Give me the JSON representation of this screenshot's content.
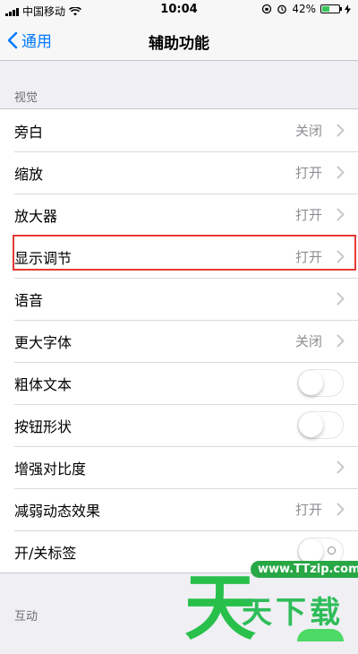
{
  "status": {
    "carrier": "中国移动",
    "time": "10:04",
    "battery": "42%",
    "battery_level": 0.42
  },
  "nav": {
    "back_label": "通用",
    "title": "辅助功能"
  },
  "sections": {
    "vision_header": "视觉",
    "interaction_header": "互动"
  },
  "rows": [
    {
      "label": "旁白",
      "value": "关闭"
    },
    {
      "label": "缩放",
      "value": "打开"
    },
    {
      "label": "放大器",
      "value": "打开"
    },
    {
      "label": "显示调节",
      "value": "打开"
    },
    {
      "label": "语音",
      "value": ""
    },
    {
      "label": "更大字体",
      "value": "关闭"
    },
    {
      "label": "粗体文本",
      "toggle": false
    },
    {
      "label": "按钮形状",
      "toggle": false
    },
    {
      "label": "增强对比度",
      "value": ""
    },
    {
      "label": "减弱动态效果",
      "value": "打开"
    },
    {
      "label": "开/关标签",
      "toggle": false
    }
  ],
  "watermark": {
    "url": "www.TTzip.com",
    "text": "天下载",
    "big": "天"
  },
  "colors": {
    "accent": "#007aff",
    "highlight": "#e53935",
    "toggle_on": "#4cd964"
  }
}
